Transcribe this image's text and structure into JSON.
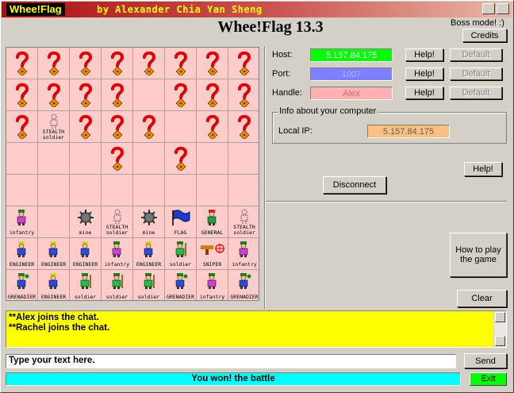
{
  "window": {
    "app_name": "Whee!Flag",
    "title_text": "by Alexander Chia Yan Sheng"
  },
  "header": {
    "title": "Whee!Flag 13.3",
    "boss_mode": "Boss mode! :)",
    "credits": "Credits"
  },
  "connection": {
    "host_label": "Host:",
    "host_value": "5.157.84.175",
    "host_color": "#00ff00",
    "port_label": "Port:",
    "port_value": "1007",
    "port_color": "#8080ff",
    "handle_label": "Handle:",
    "handle_value": "Alex",
    "handle_color": "#ffb0b0",
    "help_label": "Help!",
    "default_label": "Default"
  },
  "computer_info": {
    "group_title": "Info about your computer",
    "local_ip_label": "Local IP:",
    "local_ip_value": "5.157.84.175",
    "local_ip_color": "#ffc080"
  },
  "buttons": {
    "help": "Help!",
    "disconnect": "Disconnect",
    "how_to_play": "How to play the game",
    "clear": "Clear",
    "send": "Send",
    "exit": "Exit"
  },
  "board": {
    "rows": [
      [
        "?",
        "?",
        "?",
        "?",
        "?",
        "?",
        "?",
        "?"
      ],
      [
        "?",
        "?",
        "?",
        "?",
        "",
        "?",
        "?",
        "?"
      ],
      [
        "?",
        "STEALTH soldier",
        "?",
        "?",
        "?",
        "",
        "?",
        "?"
      ],
      [
        "",
        "",
        "",
        "?",
        "",
        "?",
        "",
        ""
      ],
      [
        "",
        "",
        "",
        "",
        "",
        "",
        "",
        ""
      ],
      [
        "infantry",
        "",
        "mine",
        "STEALTH soldier",
        "mine",
        "FLAG",
        "GENERAL",
        "STEALTH soldier"
      ],
      [
        "ENGINEER",
        "ENGINEER",
        "ENGINEER",
        "infantry",
        "ENGINEER",
        "soldier",
        "SNIPER",
        "infantry"
      ],
      [
        "GRENADIER",
        "ENGINEER",
        "soldier",
        "soldier",
        "soldier",
        "GRENADIER",
        "infantry",
        "GRENADIER"
      ]
    ]
  },
  "chat": {
    "lines": [
      "**Alex joins the chat.",
      "**Rachel joins the chat."
    ]
  },
  "input": {
    "value": "Type your text here."
  },
  "status": {
    "text": "You won! the battle",
    "color": "#00ffff"
  }
}
